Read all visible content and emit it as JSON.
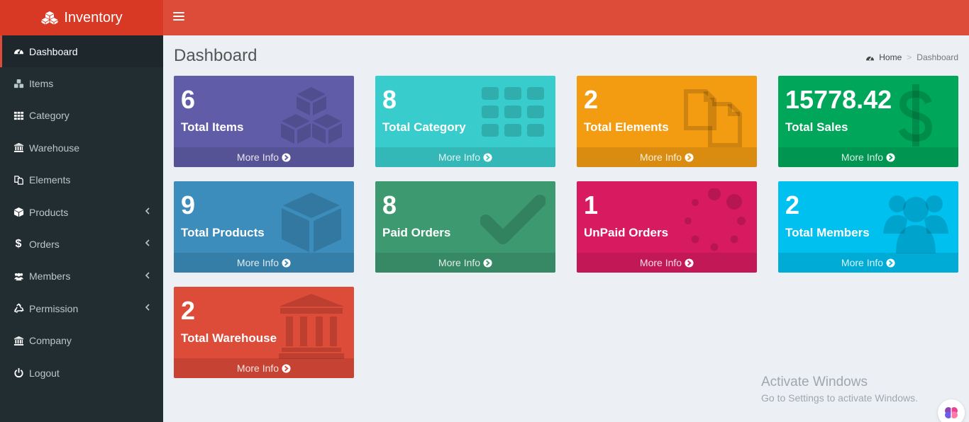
{
  "brand": {
    "name": "Inventory",
    "icon": "cubes-icon"
  },
  "sidebar": {
    "items": [
      {
        "label": "Dashboard",
        "icon": "dashboard-icon",
        "active": true
      },
      {
        "label": "Items",
        "icon": "cubes-icon"
      },
      {
        "label": "Category",
        "icon": "grid-icon"
      },
      {
        "label": "Warehouse",
        "icon": "bank-icon"
      },
      {
        "label": "Elements",
        "icon": "files-icon"
      },
      {
        "label": "Products",
        "icon": "cube-icon",
        "expandable": true
      },
      {
        "label": "Orders",
        "icon": "dollar-icon",
        "expandable": true
      },
      {
        "label": "Members",
        "icon": "users-icon",
        "expandable": true
      },
      {
        "label": "Permission",
        "icon": "recycle-icon",
        "expandable": true
      },
      {
        "label": "Company",
        "icon": "bank-icon"
      },
      {
        "label": "Logout",
        "icon": "power-icon"
      }
    ]
  },
  "page": {
    "title": "Dashboard"
  },
  "breadcrumb": {
    "home": "Home",
    "current": "Dashboard"
  },
  "boxes": [
    {
      "value": "6",
      "label": "Total Items",
      "footer": "More Info",
      "color": "#605ca8",
      "icon": "cubes-icon"
    },
    {
      "value": "8",
      "label": "Total Category",
      "footer": "More Info",
      "color": "#39cccc",
      "icon": "grid-icon"
    },
    {
      "value": "2",
      "label": "Total Elements",
      "footer": "More Info",
      "color": "#f39c12",
      "icon": "files-icon"
    },
    {
      "value": "15778.42",
      "label": "Total Sales",
      "footer": "More Info",
      "color": "#00a65a",
      "icon": "dollar-icon"
    },
    {
      "value": "9",
      "label": "Total Products",
      "footer": "More Info",
      "color": "#3c8dbc",
      "icon": "cube-icon"
    },
    {
      "value": "8",
      "label": "Paid Orders",
      "footer": "More Info",
      "color": "#3d9970",
      "icon": "check-icon"
    },
    {
      "value": "1",
      "label": "UnPaid Orders",
      "footer": "More Info",
      "color": "#d81b60",
      "icon": "spinner-icon"
    },
    {
      "value": "2",
      "label": "Total Members",
      "footer": "More Info",
      "color": "#00c0ef",
      "icon": "users-icon"
    },
    {
      "value": "2",
      "label": "Total Warehouse",
      "footer": "More Info",
      "color": "#dd4b39",
      "icon": "bank-icon"
    }
  ],
  "watermark": {
    "line1": "Activate Windows",
    "line2": "Go to Settings to activate Windows."
  }
}
